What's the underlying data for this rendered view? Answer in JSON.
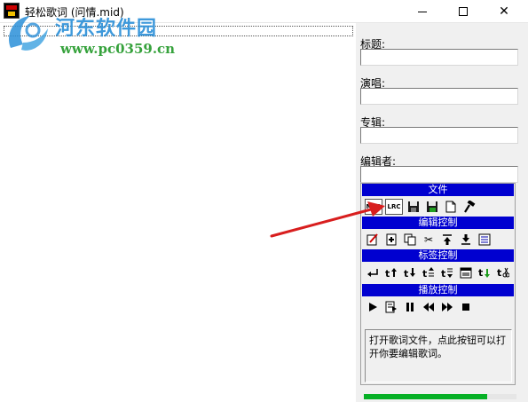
{
  "window": {
    "title": "轻松歌词 (问情.mid)"
  },
  "watermark": {
    "site_name": "河东软件园",
    "url": "www.pc0359.cn"
  },
  "fields": {
    "title_label": "标题:",
    "title_value": "",
    "artist_label": "演唱:",
    "artist_value": "",
    "album_label": "专辑:",
    "album_value": "",
    "editor_label": "编辑者:",
    "editor_value": ""
  },
  "toolbox": {
    "file_header": "文件",
    "mp3_label": "MP3",
    "lrc_label": "LRC",
    "edit_header": "编辑控制",
    "tag_header": "标签控制",
    "play_header": "播放控制"
  },
  "info": {
    "text": "打开歌词文件，点此按钮可以打开你要编辑歌词。"
  },
  "progress": {
    "value": 0.81
  },
  "colors": {
    "section_header": "#0000d0",
    "progress": "#06b025",
    "arrow": "#d81e1e"
  }
}
